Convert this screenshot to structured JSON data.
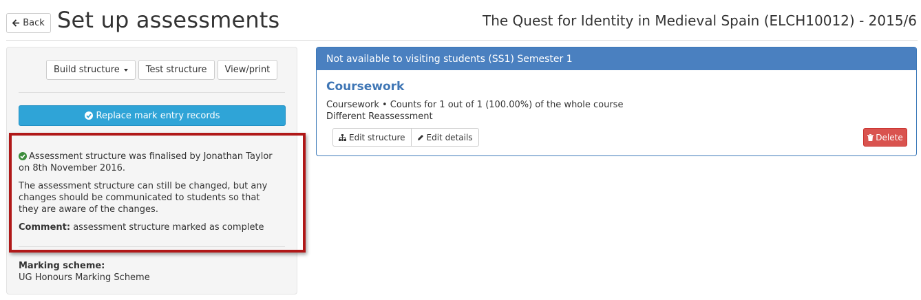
{
  "header": {
    "back_label": "Back",
    "page_title": "Set up assessments",
    "course_title": "The Quest for Identity in Medieval Spain (ELCH10012) - 2015/6"
  },
  "left_panel": {
    "buttons": {
      "build_structure": "Build structure",
      "test_structure": "Test structure",
      "view_print": "View/print"
    },
    "replace_button": "Replace mark entry records",
    "status": {
      "finalised_text": "Assessment structure was finalised by Jonathan Taylor on 8th November 2016.",
      "change_note": "The assessment structure can still be changed, but any changes should be communicated to students so that they are aware of the changes.",
      "comment_label": "Comment:",
      "comment_text": "assessment structure marked as complete"
    },
    "marking_scheme_label": "Marking scheme:",
    "marking_scheme_value": "UG Honours Marking Scheme"
  },
  "right_panel": {
    "header": "Not available to visiting students (SS1) Semester 1",
    "coursework_title": "Coursework",
    "desc_line1": "Coursework • Counts for 1 out of 1 (100.00%) of the whole course",
    "desc_line2": "Different Reassessment",
    "edit_structure": "Edit structure",
    "edit_details": "Edit details",
    "delete": "Delete"
  },
  "icons": {
    "back": "arrow-left-icon",
    "replace": "check-circle-icon",
    "status": "check-circle-icon",
    "edit_structure": "sitemap-icon",
    "edit_details": "pencil-icon",
    "delete": "trash-icon"
  },
  "colors": {
    "primary_info": "#2fa4d7",
    "panel_header": "#4a80c0",
    "link_title": "#3f76b5",
    "danger": "#d9534f",
    "success": "#3c8d3c",
    "highlight": "#b01818"
  }
}
